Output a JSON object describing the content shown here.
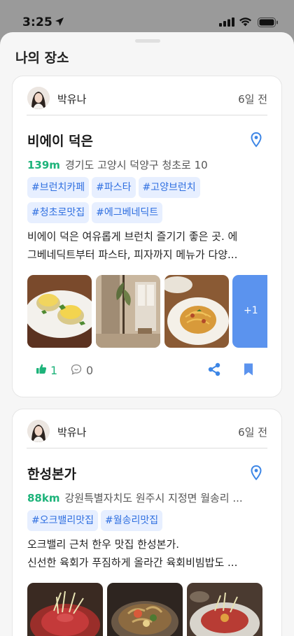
{
  "status_bar": {
    "time": "3:25"
  },
  "sheet": {
    "title": "나의 장소"
  },
  "posts": [
    {
      "author": "박유나",
      "time_ago": "6일 전",
      "place_name": "비에이 덕은",
      "distance": "139m",
      "address": "경기도 고양시 덕양구 청초로 10",
      "tags": [
        "#브런치카페",
        "#파스타",
        "#고양브런치",
        "#청초로맛집",
        "#에그베네딕트"
      ],
      "description_lines": [
        "비에이 덕은 여유롭게 브런치 즐기기 좋은 곳. 에",
        "그베네딕트부터 파스타, 피자까지 메뉴가 다양..."
      ],
      "more_photos": "+1",
      "likes": "1",
      "comments": "0"
    },
    {
      "author": "박유나",
      "time_ago": "6일 전",
      "place_name": "한성본가",
      "distance": "88km",
      "address": "강원특별자치도 원주시 지정면 월송리 ...",
      "tags": [
        "#오크밸리맛집",
        "#월송리맛집"
      ],
      "description_lines": [
        "오크밸리 근처 한우 맛집 한성본가.",
        "신선한 육회가 푸짐하게 올라간 육회비빔밥도 ..."
      ]
    }
  ],
  "colors": {
    "accent_green": "#1db37a",
    "accent_blue": "#2f6fe0",
    "tag_bg": "#e7efff",
    "more_tile": "#5b93ee"
  }
}
